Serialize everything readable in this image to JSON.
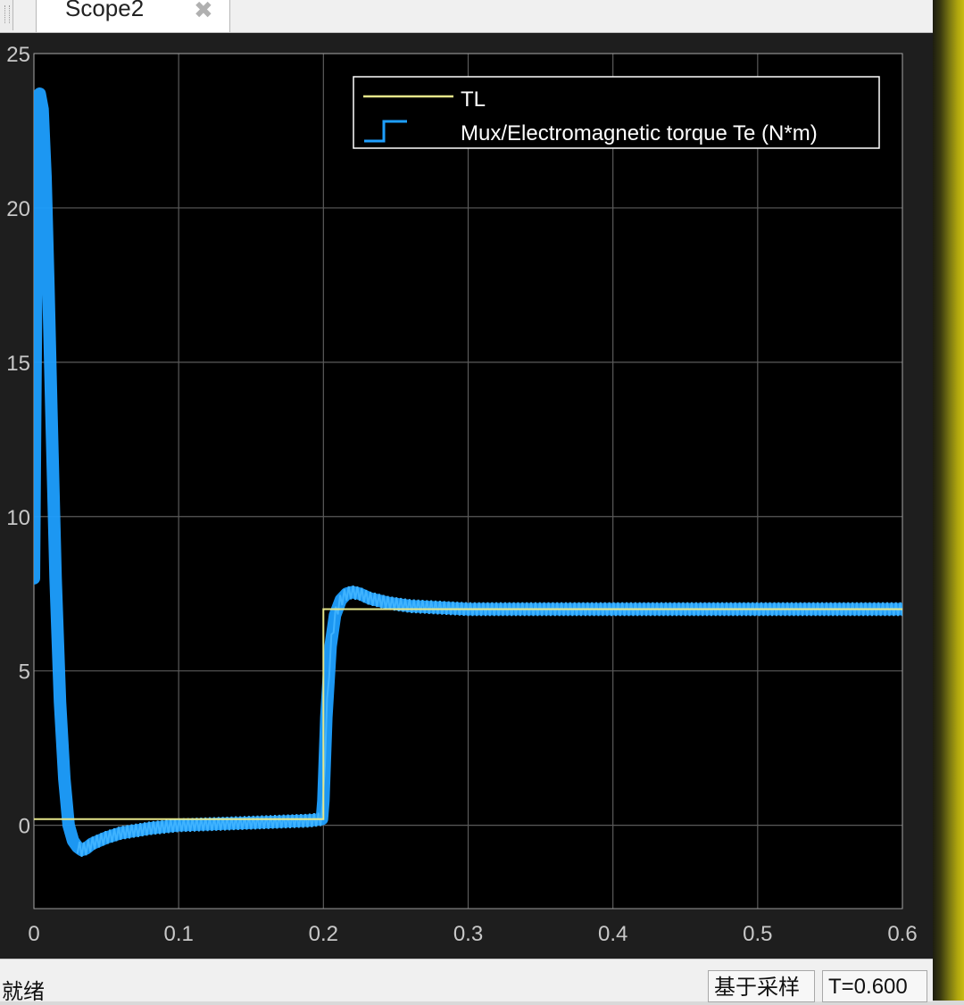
{
  "window": {
    "tab_title": "Scope2"
  },
  "status": {
    "ready": "就绪",
    "mode": "基于采样",
    "time": "T=0.600"
  },
  "colors": {
    "background": "#000000",
    "axes_frame": "#1e1e1e",
    "grid": "#5a5a5a",
    "tick_text": "#c8c8c8",
    "legend_border": "#ffffff",
    "TL": "#e6e68a",
    "Te": "#1e9fff"
  },
  "chart_data": {
    "type": "line",
    "title": "",
    "xlabel": "",
    "ylabel": "",
    "xlim": [
      0,
      0.6
    ],
    "ylim": [
      -2.7,
      25
    ],
    "xticks": [
      "0",
      "0.1",
      "0.2",
      "0.3",
      "0.4",
      "0.5",
      "0.6"
    ],
    "yticks": [
      "0",
      "5",
      "10",
      "15",
      "20",
      "25"
    ],
    "grid": true,
    "legend_position": "top-right",
    "series": [
      {
        "name": "TL",
        "color": "#e6e68a",
        "x": [
          0,
          0.2,
          0.2,
          0.6
        ],
        "y": [
          0.2,
          0.2,
          7.0,
          7.0
        ]
      },
      {
        "name": "Mux/Electromagnetic torque Te (N*m)",
        "color": "#1e9fff",
        "x": [
          0,
          0.002,
          0.004,
          0.006,
          0.008,
          0.01,
          0.012,
          0.015,
          0.018,
          0.021,
          0.024,
          0.027,
          0.03,
          0.033,
          0.036,
          0.04,
          0.05,
          0.06,
          0.08,
          0.1,
          0.13,
          0.16,
          0.19,
          0.199,
          0.2,
          0.202,
          0.205,
          0.208,
          0.212,
          0.216,
          0.22,
          0.225,
          0.232,
          0.245,
          0.26,
          0.28,
          0.3,
          0.35,
          0.4,
          0.45,
          0.5,
          0.55,
          0.6
        ],
        "y": [
          8.0,
          20.0,
          23.7,
          23.2,
          21.0,
          17.5,
          13.5,
          8.0,
          4.0,
          1.5,
          0.0,
          -0.5,
          -0.7,
          -0.8,
          -0.75,
          -0.6,
          -0.4,
          -0.25,
          -0.1,
          0.0,
          0.05,
          0.1,
          0.15,
          0.2,
          0.8,
          3.5,
          5.8,
          6.8,
          7.3,
          7.5,
          7.55,
          7.5,
          7.35,
          7.2,
          7.1,
          7.05,
          7.0,
          7.0,
          7.0,
          7.0,
          7.0,
          7.0,
          7.0
        ]
      }
    ]
  }
}
